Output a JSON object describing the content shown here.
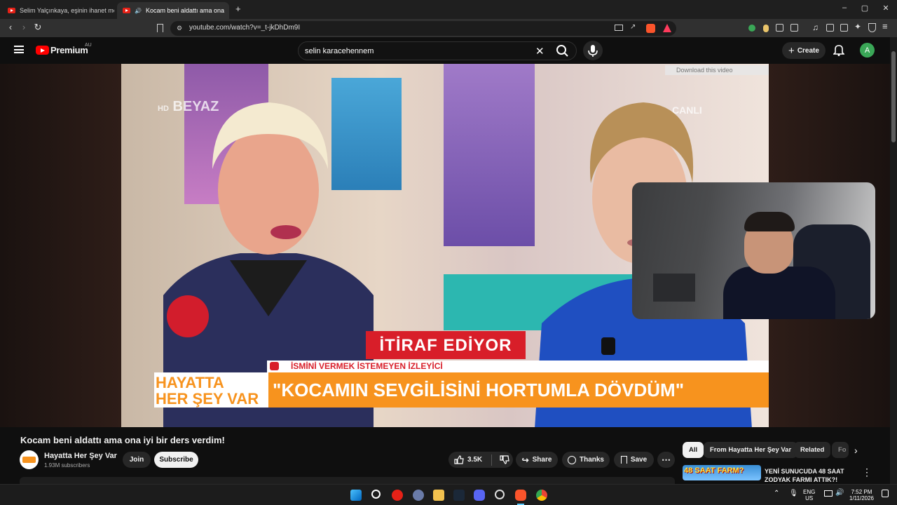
{
  "browser": {
    "tabs": [
      {
        "title": "Selim Yalçınkaya, eşinin ihanet mesaj",
        "active": false
      },
      {
        "title": "Kocam beni aldattı ama ona",
        "active": true
      }
    ],
    "new_tab": "+",
    "window_controls": [
      "–",
      "▢",
      "✕"
    ],
    "url": "youtube.com/watch?v=_t-jkDhDm9I"
  },
  "youtube": {
    "logo_text": "Premium",
    "logo_region": "AU",
    "search_value": "selin karacehennem",
    "create_label": "Create",
    "avatar_letter": "A"
  },
  "video_overlay": {
    "channel_logo": "BEYAZ",
    "logo_prefix": "HD",
    "live": "CANLI",
    "download_bar": "Download this video",
    "headline_tag": "İTİRAF EDİYOR",
    "ticker": "İSMİNİ VERMEK İSTEMEYEN İZLEYİCİ",
    "show_name_1": "HAYATTA",
    "show_name_2": "HER ŞEY VAR",
    "quote": "\"KOCAMIN SEVGİLİSİNİ HORTUMLA DÖVDÜM\""
  },
  "video": {
    "title": "Kocam beni aldattı ama ona iyi bir ders verdim!",
    "channel": "Hayatta Her Şey Var",
    "subscribers": "1.93M subscribers",
    "join_label": "Join",
    "subscribe_label": "Subscribe",
    "likes": "3.5K",
    "share_label": "Share",
    "thanks_label": "Thanks",
    "save_label": "Save"
  },
  "related": {
    "chips": [
      "All",
      "From Hayatta Her Şey Var",
      "Related",
      "Fo"
    ],
    "item": {
      "thumb_text": "48 SAAT FARM?",
      "title": "YENİ SUNUCUDA 48 SAAT ZODYAK FARMI ATTIK?!"
    }
  },
  "taskbar": {
    "language_1": "ENG",
    "language_2": "US",
    "time": "7:52 PM",
    "date": "1/11/2026"
  },
  "colors": {
    "yt_red": "#ff0000",
    "accent_orange": "#f7931e",
    "banner_red": "#d81e29"
  }
}
